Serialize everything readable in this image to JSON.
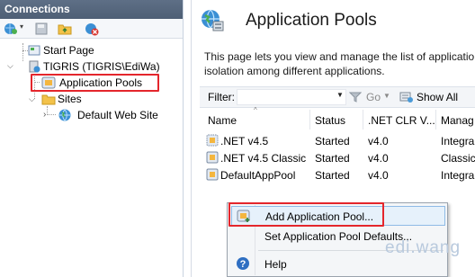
{
  "connections": {
    "header": "Connections",
    "tree": {
      "start_page": "Start Page",
      "server": "TIGRIS (TIGRIS\\EdiWa)",
      "app_pools": "Application Pools",
      "sites": "Sites",
      "default_site": "Default Web Site"
    }
  },
  "main": {
    "title": "Application Pools",
    "description_line1": "This page lets you view and manage the list of applicatio",
    "description_line2": "isolation among different applications.",
    "filter": {
      "label": "Filter:",
      "value": "",
      "go_label": "Go",
      "show_all_label": "Show All"
    },
    "table": {
      "columns": [
        "Name",
        "Status",
        ".NET CLR V...",
        "Manag"
      ],
      "rows": [
        {
          "name": ".NET v4.5",
          "status": "Started",
          "clr": "v4.0",
          "pipeline": "Integra"
        },
        {
          "name": ".NET v4.5 Classic",
          "status": "Started",
          "clr": "v4.0",
          "pipeline": "Classic"
        },
        {
          "name": "DefaultAppPool",
          "status": "Started",
          "clr": "v4.0",
          "pipeline": "Integra"
        }
      ]
    }
  },
  "context_menu": {
    "items": [
      {
        "label": "Add Application Pool...",
        "icon": "add-app-pool-icon",
        "highlighted": true
      },
      {
        "label": "Set Application Pool Defaults...",
        "icon": "",
        "highlighted": false
      },
      {
        "label": "Help",
        "icon": "help-icon",
        "highlighted": false
      }
    ]
  },
  "watermark": "edi.wang",
  "colors": {
    "highlight_border": "#e4262c",
    "header_bg": "#56677d",
    "menu_hover": "#e6f1fb"
  }
}
